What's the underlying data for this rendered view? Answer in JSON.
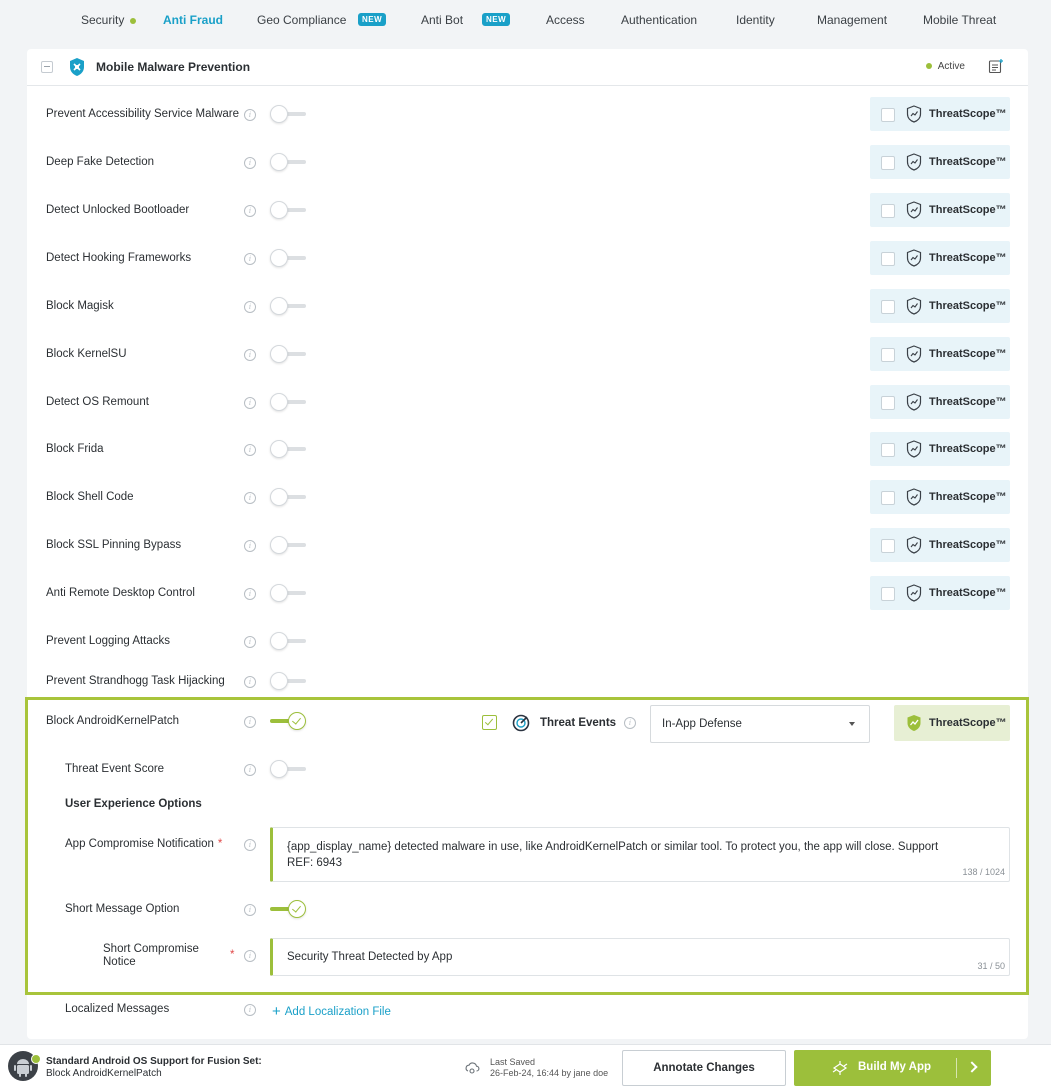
{
  "nav": {
    "tabs": [
      {
        "label": "Security",
        "status_dot": true
      },
      {
        "label": "Anti Fraud",
        "active": true
      },
      {
        "label": "Geo Compliance",
        "badge": "NEW"
      },
      {
        "label": "Anti Bot",
        "badge": "NEW"
      },
      {
        "label": "Access"
      },
      {
        "label": "Authentication"
      },
      {
        "label": "Identity"
      },
      {
        "label": "Management"
      },
      {
        "label": "Mobile Threat"
      }
    ]
  },
  "panel": {
    "title": "Mobile Malware Prevention",
    "status": "Active",
    "features": [
      {
        "label": "Prevent Accessibility Service Malware",
        "enabled": false,
        "threatscope": "ThreatScope™"
      },
      {
        "label": "Deep Fake Detection",
        "enabled": false,
        "threatscope": "ThreatScope™"
      },
      {
        "label": "Detect Unlocked Bootloader",
        "enabled": false,
        "threatscope": "ThreatScope™"
      },
      {
        "label": "Detect Hooking Frameworks",
        "enabled": false,
        "threatscope": "ThreatScope™"
      },
      {
        "label": "Block Magisk",
        "enabled": false,
        "threatscope": "ThreatScope™"
      },
      {
        "label": "Block KernelSU",
        "enabled": false,
        "threatscope": "ThreatScope™"
      },
      {
        "label": "Detect OS Remount",
        "enabled": false,
        "threatscope": "ThreatScope™"
      },
      {
        "label": "Block Frida",
        "enabled": false,
        "threatscope": "ThreatScope™"
      },
      {
        "label": "Block Shell Code",
        "enabled": false,
        "threatscope": "ThreatScope™"
      },
      {
        "label": "Block SSL Pinning Bypass",
        "enabled": false,
        "threatscope": "ThreatScope™"
      },
      {
        "label": "Anti Remote Desktop Control",
        "enabled": false,
        "threatscope": "ThreatScope™"
      },
      {
        "label": "Prevent Logging Attacks",
        "enabled": false
      },
      {
        "label": "Prevent Strandhogg Task Hijacking",
        "enabled": false
      }
    ],
    "selected_feature": {
      "label": "Block AndroidKernelPatch",
      "enabled": true,
      "threat_events_checked": true,
      "threat_events_label": "Threat Events",
      "defense_select": "In-App Defense",
      "threatscope": "ThreatScope™",
      "threat_event_score_label": "Threat Event Score",
      "threat_event_score_enabled": false,
      "ux_title": "User Experience Options",
      "notification_label": "App Compromise Notification",
      "required_mark": "*",
      "notification_text": "{app_display_name} detected malware in use, like AndroidKernelPatch or similar tool. To protect you, the app will close. Support REF: 6943",
      "notification_count": "138 / 1024",
      "short_message_label": "Short Message Option",
      "short_message_enabled": true,
      "short_notice_label_line1": "Short Compromise",
      "short_notice_label_line2": "Notice",
      "short_notice_text": "Security Threat Detected by App",
      "short_notice_count": "31 / 50"
    },
    "localized_label": "Localized Messages",
    "add_localization": "Add Localization File"
  },
  "footer": {
    "title": "Standard Android OS Support for Fusion Set:",
    "subtitle": "Block AndroidKernelPatch",
    "saved_label": "Last Saved",
    "saved_value": "26-Feb-24, 16:44 by jane doe",
    "annotate_button": "Annotate Changes",
    "build_button": "Build My App"
  },
  "colors": {
    "accent": "#1aa0c8",
    "green": "#9cbf3b",
    "threatscope_bg": "#e8f4f9"
  }
}
